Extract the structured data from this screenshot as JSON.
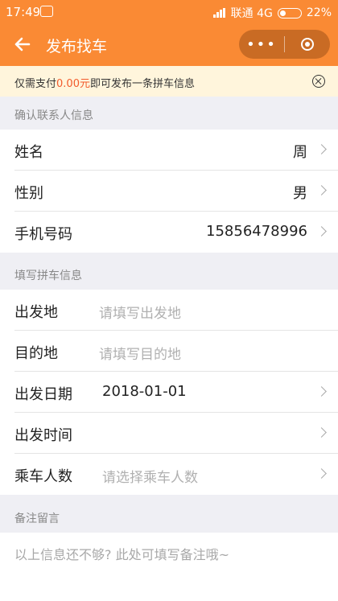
{
  "status_bar": {
    "time": "17:49",
    "carrier": "联通 4G",
    "battery": "22%"
  },
  "nav": {
    "title": "发布找车",
    "more_icon": "•••",
    "close_icon": "record-icon"
  },
  "notice": {
    "prefix": "仅需支付",
    "amount": "0.00元",
    "suffix": "即可发布一条拼车信息"
  },
  "contact": {
    "header": "确认联系人信息",
    "name_label": "姓名",
    "name_value": "周",
    "gender_label": "性别",
    "gender_value": "男",
    "phone_label": "手机号码",
    "phone_value": "15856478996"
  },
  "trip": {
    "header": "填写拼车信息",
    "departure_label": "出发地",
    "departure_placeholder": "请填写出发地",
    "destination_label": "目的地",
    "destination_placeholder": "请填写目的地",
    "date_label": "出发日期",
    "date_value": "2018-01-01",
    "time_label": "出发时间",
    "passengers_label": "乘车人数",
    "passengers_placeholder": "请选择乘车人数"
  },
  "remarks": {
    "header": "备注留言",
    "placeholder": "以上信息还不够? 此处可填写备注哦~"
  },
  "colors": {
    "primary": "#fa8a34",
    "amount": "#f25b2c",
    "notice_bg": "#fff5dc"
  }
}
